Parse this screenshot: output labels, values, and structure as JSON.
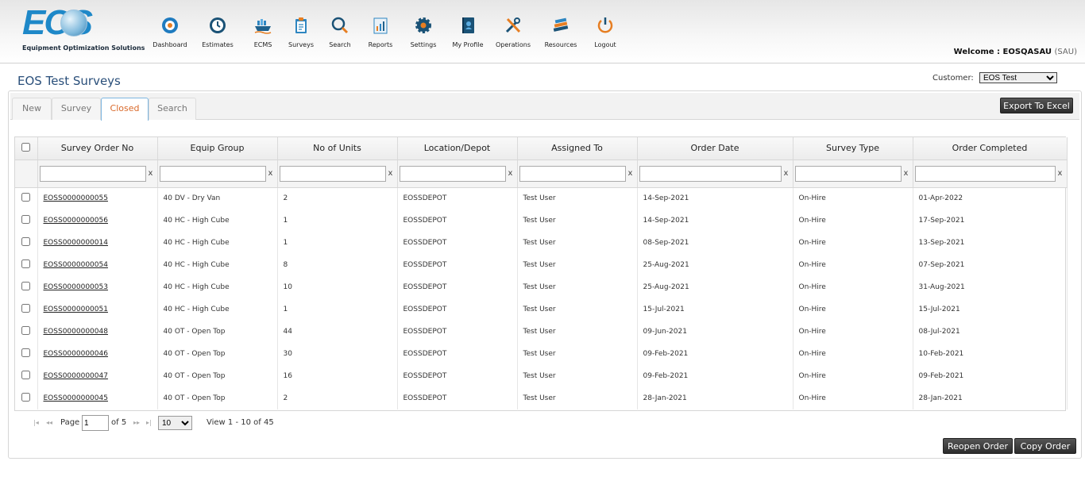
{
  "logo": {
    "word": "EOS",
    "tagline": "Equipment Optimization Solutions"
  },
  "nav": [
    {
      "label": "Dashboard",
      "icon": "dashboard-icon"
    },
    {
      "label": "Estimates",
      "icon": "clock-icon"
    },
    {
      "label": "ECMS",
      "icon": "ship-icon"
    },
    {
      "label": "Surveys",
      "icon": "clipboard-icon"
    },
    {
      "label": "Search",
      "icon": "search-icon"
    },
    {
      "label": "Reports",
      "icon": "report-icon"
    },
    {
      "label": "Settings",
      "icon": "gear-icon"
    },
    {
      "label": "My Profile",
      "icon": "profile-book-icon"
    },
    {
      "label": "Operations",
      "icon": "tools-icon"
    },
    {
      "label": "Resources",
      "icon": "books-icon"
    },
    {
      "label": "Logout",
      "icon": "power-icon"
    }
  ],
  "welcome": {
    "prefix": "Welcome : EOSQASAU",
    "suffix": "(SAU)"
  },
  "page_title": "EOS Test Surveys",
  "customer": {
    "label": "Customer:",
    "selected": "EOS Test"
  },
  "tabs": [
    {
      "label": "New",
      "active": false
    },
    {
      "label": "Survey",
      "active": false
    },
    {
      "label": "Closed",
      "active": true
    },
    {
      "label": "Search",
      "active": false
    }
  ],
  "export_label": "Export To Excel",
  "columns": [
    "Survey Order No",
    "Equip Group",
    "No of Units",
    "Location/Depot",
    "Assigned To",
    "Order Date",
    "Survey Type",
    "Order Completed"
  ],
  "filter_clear": "x",
  "rows": [
    [
      "EOSS0000000055",
      "40 DV - Dry Van",
      "2",
      "EOSSDEPOT",
      "Test User",
      "14-Sep-2021",
      "On-Hire",
      "01-Apr-2022"
    ],
    [
      "EOSS0000000056",
      "40 HC - High Cube",
      "1",
      "EOSSDEPOT",
      "Test User",
      "14-Sep-2021",
      "On-Hire",
      "17-Sep-2021"
    ],
    [
      "EOSS0000000014",
      "40 HC - High Cube",
      "1",
      "EOSSDEPOT",
      "Test User",
      "08-Sep-2021",
      "On-Hire",
      "13-Sep-2021"
    ],
    [
      "EOSS0000000054",
      "40 HC - High Cube",
      "8",
      "EOSSDEPOT",
      "Test User",
      "25-Aug-2021",
      "On-Hire",
      "07-Sep-2021"
    ],
    [
      "EOSS0000000053",
      "40 HC - High Cube",
      "10",
      "EOSSDEPOT",
      "Test User",
      "25-Aug-2021",
      "On-Hire",
      "31-Aug-2021"
    ],
    [
      "EOSS0000000051",
      "40 HC - High Cube",
      "1",
      "EOSSDEPOT",
      "Test User",
      "15-Jul-2021",
      "On-Hire",
      "15-Jul-2021"
    ],
    [
      "EOSS0000000048",
      "40 OT - Open Top",
      "44",
      "EOSSDEPOT",
      "Test User",
      "09-Jun-2021",
      "On-Hire",
      "08-Jul-2021"
    ],
    [
      "EOSS0000000046",
      "40 OT - Open Top",
      "30",
      "EOSSDEPOT",
      "Test User",
      "09-Feb-2021",
      "On-Hire",
      "10-Feb-2021"
    ],
    [
      "EOSS0000000047",
      "40 OT - Open Top",
      "16",
      "EOSSDEPOT",
      "Test User",
      "09-Feb-2021",
      "On-Hire",
      "09-Feb-2021"
    ],
    [
      "EOSS0000000045",
      "40 OT - Open Top",
      "2",
      "EOSSDEPOT",
      "Test User",
      "28-Jan-2021",
      "On-Hire",
      "28-Jan-2021"
    ]
  ],
  "pager": {
    "page_label": "Page",
    "page_value": "1",
    "of_label": "of 5",
    "page_size": "10",
    "view_text": "View 1 - 10 of 45"
  },
  "actions": {
    "reopen": "Reopen Order",
    "copy": "Copy Order"
  },
  "colors": {
    "accent": "#d9692a",
    "title": "#2a4f7a",
    "button": "#333333"
  }
}
